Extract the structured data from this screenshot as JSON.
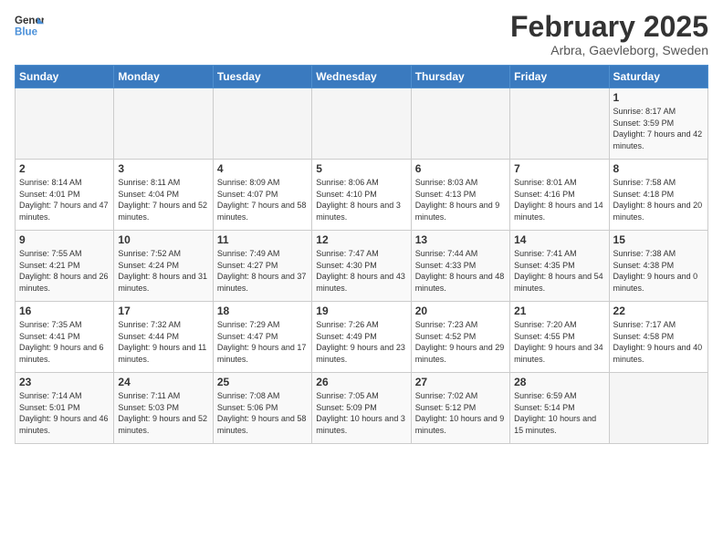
{
  "header": {
    "logo_line1": "General",
    "logo_line2": "Blue",
    "month": "February 2025",
    "location": "Arbra, Gaevleborg, Sweden"
  },
  "days_of_week": [
    "Sunday",
    "Monday",
    "Tuesday",
    "Wednesday",
    "Thursday",
    "Friday",
    "Saturday"
  ],
  "weeks": [
    [
      {
        "day": "",
        "info": ""
      },
      {
        "day": "",
        "info": ""
      },
      {
        "day": "",
        "info": ""
      },
      {
        "day": "",
        "info": ""
      },
      {
        "day": "",
        "info": ""
      },
      {
        "day": "",
        "info": ""
      },
      {
        "day": "1",
        "info": "Sunrise: 8:17 AM\nSunset: 3:59 PM\nDaylight: 7 hours and 42 minutes."
      }
    ],
    [
      {
        "day": "2",
        "info": "Sunrise: 8:14 AM\nSunset: 4:01 PM\nDaylight: 7 hours and 47 minutes."
      },
      {
        "day": "3",
        "info": "Sunrise: 8:11 AM\nSunset: 4:04 PM\nDaylight: 7 hours and 52 minutes."
      },
      {
        "day": "4",
        "info": "Sunrise: 8:09 AM\nSunset: 4:07 PM\nDaylight: 7 hours and 58 minutes."
      },
      {
        "day": "5",
        "info": "Sunrise: 8:06 AM\nSunset: 4:10 PM\nDaylight: 8 hours and 3 minutes."
      },
      {
        "day": "6",
        "info": "Sunrise: 8:03 AM\nSunset: 4:13 PM\nDaylight: 8 hours and 9 minutes."
      },
      {
        "day": "7",
        "info": "Sunrise: 8:01 AM\nSunset: 4:16 PM\nDaylight: 8 hours and 14 minutes."
      },
      {
        "day": "8",
        "info": "Sunrise: 7:58 AM\nSunset: 4:18 PM\nDaylight: 8 hours and 20 minutes."
      }
    ],
    [
      {
        "day": "9",
        "info": "Sunrise: 7:55 AM\nSunset: 4:21 PM\nDaylight: 8 hours and 26 minutes."
      },
      {
        "day": "10",
        "info": "Sunrise: 7:52 AM\nSunset: 4:24 PM\nDaylight: 8 hours and 31 minutes."
      },
      {
        "day": "11",
        "info": "Sunrise: 7:49 AM\nSunset: 4:27 PM\nDaylight: 8 hours and 37 minutes."
      },
      {
        "day": "12",
        "info": "Sunrise: 7:47 AM\nSunset: 4:30 PM\nDaylight: 8 hours and 43 minutes."
      },
      {
        "day": "13",
        "info": "Sunrise: 7:44 AM\nSunset: 4:33 PM\nDaylight: 8 hours and 48 minutes."
      },
      {
        "day": "14",
        "info": "Sunrise: 7:41 AM\nSunset: 4:35 PM\nDaylight: 8 hours and 54 minutes."
      },
      {
        "day": "15",
        "info": "Sunrise: 7:38 AM\nSunset: 4:38 PM\nDaylight: 9 hours and 0 minutes."
      }
    ],
    [
      {
        "day": "16",
        "info": "Sunrise: 7:35 AM\nSunset: 4:41 PM\nDaylight: 9 hours and 6 minutes."
      },
      {
        "day": "17",
        "info": "Sunrise: 7:32 AM\nSunset: 4:44 PM\nDaylight: 9 hours and 11 minutes."
      },
      {
        "day": "18",
        "info": "Sunrise: 7:29 AM\nSunset: 4:47 PM\nDaylight: 9 hours and 17 minutes."
      },
      {
        "day": "19",
        "info": "Sunrise: 7:26 AM\nSunset: 4:49 PM\nDaylight: 9 hours and 23 minutes."
      },
      {
        "day": "20",
        "info": "Sunrise: 7:23 AM\nSunset: 4:52 PM\nDaylight: 9 hours and 29 minutes."
      },
      {
        "day": "21",
        "info": "Sunrise: 7:20 AM\nSunset: 4:55 PM\nDaylight: 9 hours and 34 minutes."
      },
      {
        "day": "22",
        "info": "Sunrise: 7:17 AM\nSunset: 4:58 PM\nDaylight: 9 hours and 40 minutes."
      }
    ],
    [
      {
        "day": "23",
        "info": "Sunrise: 7:14 AM\nSunset: 5:01 PM\nDaylight: 9 hours and 46 minutes."
      },
      {
        "day": "24",
        "info": "Sunrise: 7:11 AM\nSunset: 5:03 PM\nDaylight: 9 hours and 52 minutes."
      },
      {
        "day": "25",
        "info": "Sunrise: 7:08 AM\nSunset: 5:06 PM\nDaylight: 9 hours and 58 minutes."
      },
      {
        "day": "26",
        "info": "Sunrise: 7:05 AM\nSunset: 5:09 PM\nDaylight: 10 hours and 3 minutes."
      },
      {
        "day": "27",
        "info": "Sunrise: 7:02 AM\nSunset: 5:12 PM\nDaylight: 10 hours and 9 minutes."
      },
      {
        "day": "28",
        "info": "Sunrise: 6:59 AM\nSunset: 5:14 PM\nDaylight: 10 hours and 15 minutes."
      },
      {
        "day": "",
        "info": ""
      }
    ]
  ]
}
